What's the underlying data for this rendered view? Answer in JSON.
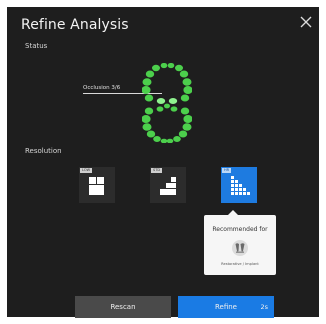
{
  "dialog": {
    "title": "Refine Analysis",
    "close_icon": "close-icon"
  },
  "status": {
    "label": "Status",
    "occlusion_text": "Occlusion 3/6",
    "teeth_color": "#4ccf4c",
    "teeth_highlight_color": "#8ff28f"
  },
  "resolution": {
    "label": "Resolution",
    "options": [
      {
        "tag": "LOW",
        "selected": false
      },
      {
        "tag": "STD",
        "selected": false
      },
      {
        "tag": "HR",
        "selected": true
      }
    ],
    "accent_color": "#1e7be0"
  },
  "popover": {
    "title": "Recommended for",
    "icon": "teeth-icon",
    "caption": "Restorative / Implant"
  },
  "buttons": {
    "rescan_label": "Rescan",
    "refine_label": "Refine",
    "refine_timer": "2s",
    "refine_color": "#1a7be4"
  }
}
